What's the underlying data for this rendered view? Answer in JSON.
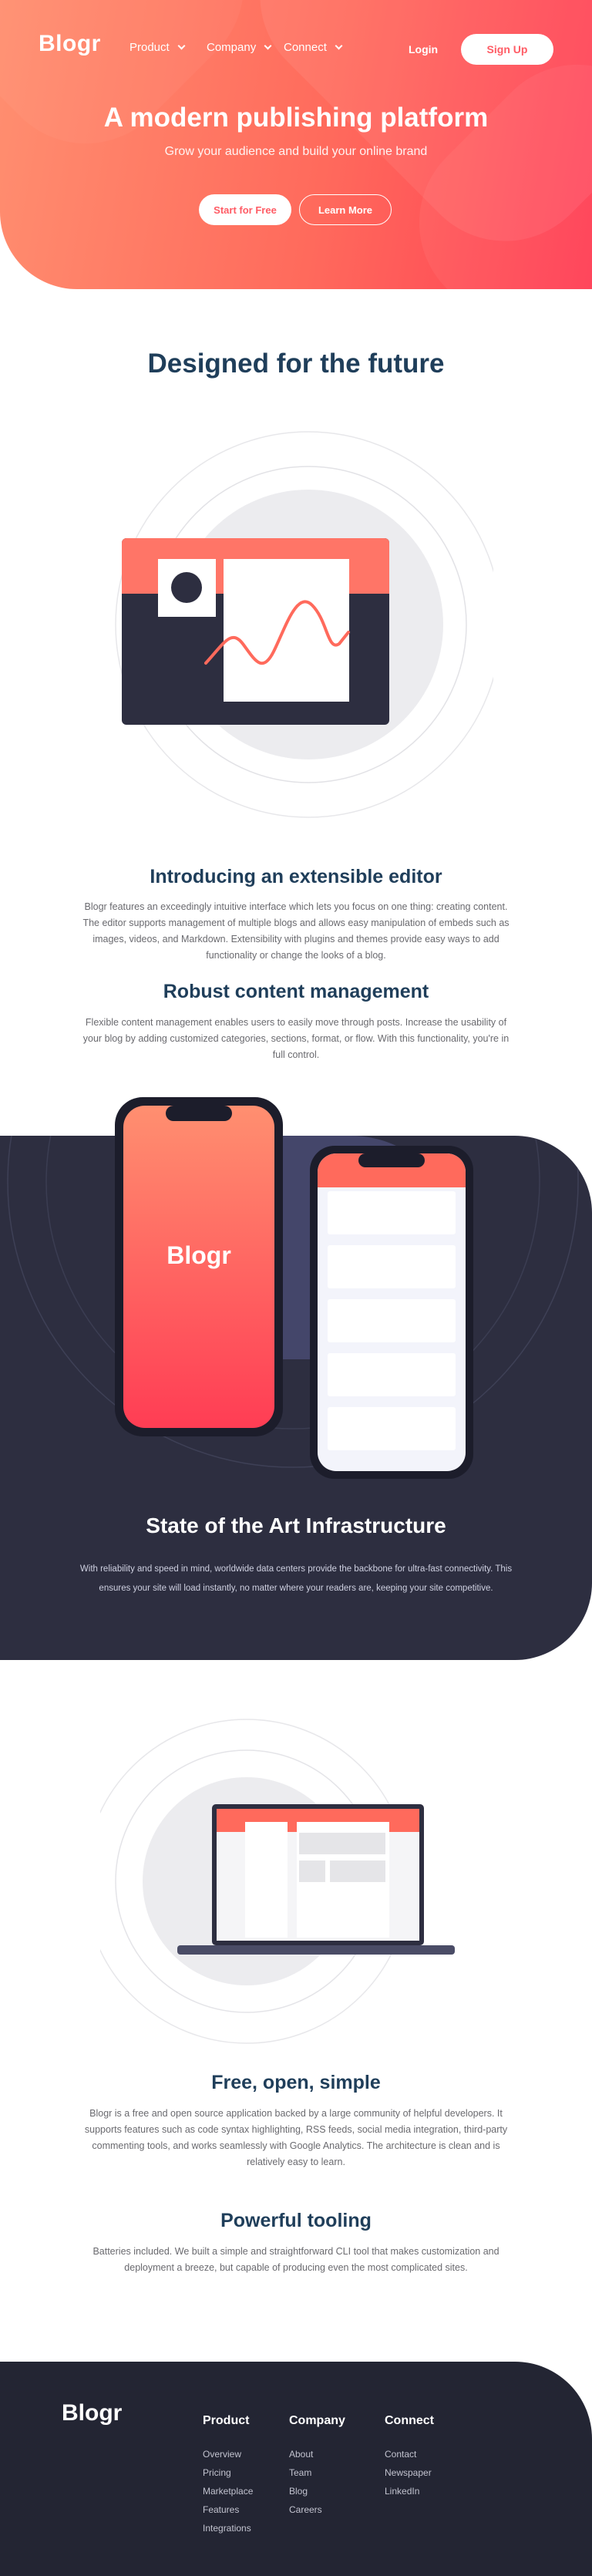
{
  "nav": {
    "logo": "Blogr",
    "items": [
      {
        "label": "Product"
      },
      {
        "label": "Company"
      },
      {
        "label": "Connect"
      }
    ],
    "login": "Login",
    "signup": "Sign Up"
  },
  "hero": {
    "title": "A modern publishing platform",
    "subtitle": "Grow your audience and build your online brand",
    "start_button": "Start for Free",
    "learn_button": "Learn More"
  },
  "designed": {
    "title": "Designed for the future",
    "features": [
      {
        "title": "Introducing an extensible editor",
        "lines": [
          "Blogr features an exceedingly intuitive interface which lets you focus on one thing: creating content.",
          "The editor supports management of multiple blogs and allows easy manipulation of embeds such as",
          "images, videos, and Markdown. Extensibility with plugins and themes provide easy ways to add",
          "functionality or change the looks of a blog."
        ]
      },
      {
        "title": "Robust content management",
        "lines": [
          "Flexible content management enables users to easily move through posts. Increase the usability of",
          "your blog by adding customized categories, sections, format, or flow. With this functionality, you're in",
          "full control."
        ]
      }
    ]
  },
  "infra": {
    "phone_logo": "Blogr",
    "title": "State of the Art Infrastructure",
    "lines": [
      "With reliability and speed in mind, worldwide data centers provide the backbone for ultra-fast connectivity. This",
      "ensures your site will load instantly, no matter where your readers are, keeping your site competitive."
    ]
  },
  "features2": [
    {
      "title": "Free, open, simple",
      "lines": [
        "Blogr is a free and open source application backed by a large community of helpful developers. It",
        "supports features such as code syntax highlighting, RSS feeds, social media integration, third-party",
        "commenting tools, and works seamlessly with Google Analytics. The architecture is clean and is",
        "relatively easy to learn."
      ]
    },
    {
      "title": "Powerful tooling",
      "lines": [
        "Batteries included. We built a simple and straightforward CLI tool that makes customization and",
        "deployment a breeze, but capable of producing even the most complicated sites."
      ]
    }
  ],
  "footer": {
    "logo": "Blogr",
    "columns": [
      {
        "heading": "Product",
        "links": [
          "Overview",
          "Pricing",
          "Marketplace",
          "Features",
          "Integrations"
        ]
      },
      {
        "heading": "Company",
        "links": [
          "About",
          "Team",
          "Blog",
          "Careers"
        ]
      },
      {
        "heading": "Connect",
        "links": [
          "Contact",
          "Newspaper",
          "LinkedIn"
        ]
      }
    ]
  },
  "colors": {
    "accent": "#ff5c65",
    "hero_start": "#ff8f70",
    "hero_end": "#ff3d54",
    "heading": "#1f3e5a",
    "dark": "#2d2e40",
    "footer": "#232533"
  }
}
